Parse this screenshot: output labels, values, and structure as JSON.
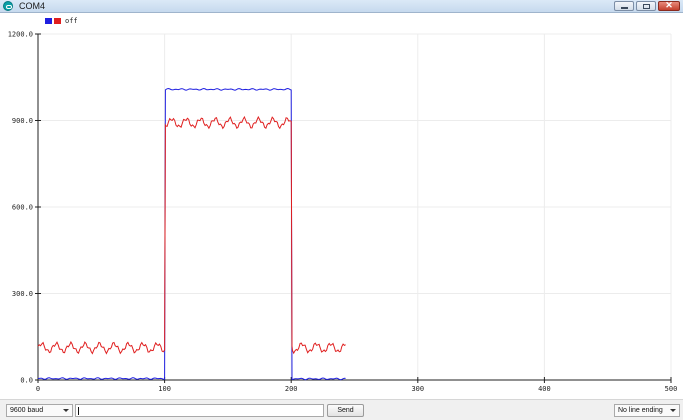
{
  "window": {
    "title": "COM4"
  },
  "legend": {
    "label": "off",
    "swatch_colors": [
      "#1f1fe0",
      "#e01f1f"
    ]
  },
  "chart_data": {
    "type": "line",
    "x_range": [
      0,
      500
    ],
    "y_range": [
      0,
      1200
    ],
    "x_ticks": [
      "0",
      "100",
      "200",
      "300",
      "400",
      "500"
    ],
    "y_ticks": [
      "0.0",
      "300.0",
      "600.0",
      "900.0",
      "1200.0"
    ],
    "grid": true,
    "legend_position": "top-left",
    "series": [
      {
        "name": "off",
        "color": "#1f1fe0",
        "segments": [
          {
            "x_start": 0,
            "x_end": 100,
            "y": 5
          },
          {
            "x_start": 100,
            "x_end": 200,
            "y": 1008
          },
          {
            "x_start": 200,
            "x_end": 243,
            "y": 4
          }
        ]
      },
      {
        "color": "#e01f1f",
        "segments": [
          {
            "x_start": 0,
            "x_end": 100,
            "y": 112
          },
          {
            "x_start": 100,
            "x_end": 200,
            "y": 892
          },
          {
            "x_start": 200,
            "x_end": 243,
            "y": 112
          }
        ]
      }
    ]
  },
  "bottom_bar": {
    "baud": "9600 baud",
    "input_value": "",
    "send": "Send",
    "line_ending": "No line ending"
  },
  "icons": {
    "app": "arduino-icon",
    "minimize": "minimize-icon",
    "maximize": "maximize-icon",
    "close": "close-icon",
    "dropdown": "chevron-down-icon"
  }
}
